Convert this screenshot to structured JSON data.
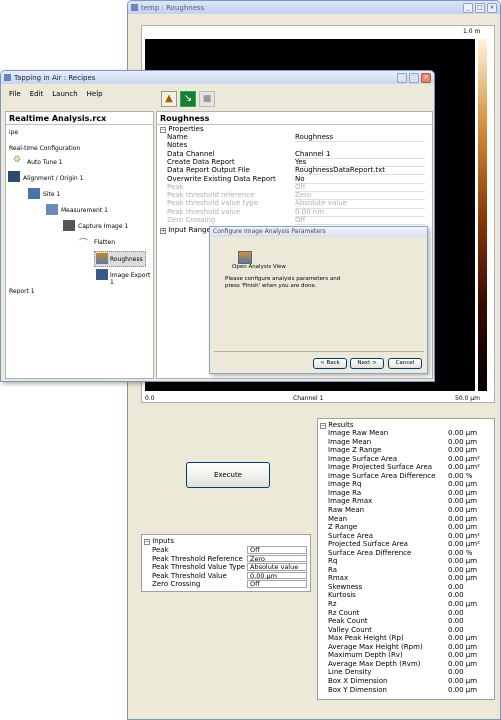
{
  "main_window": {
    "title": "temp : Roughness",
    "axis_top_right": "1.0 m",
    "x_axis_start": "0.0",
    "x_axis_label": "Channel 1",
    "x_axis_end": "50.0 µm",
    "toolbar_icons": [
      "pencil-icon",
      "page-icon",
      "zoom-in-icon",
      "zoom-out-icon",
      "ruler-icon"
    ]
  },
  "recipes_window": {
    "title": "Tapping in Air : Recipes",
    "menu": [
      "File",
      "Edit",
      "Launch",
      "Help"
    ],
    "recipe_title": "Realtime Analysis.rcx",
    "tree": {
      "ipe": "ipe",
      "realtime_configuration": "Real-time Configuration",
      "auto_tune": "Auto Tune 1",
      "alignment": "Alignment / Origin 1",
      "site": "Site 1",
      "measurement": "Measurement 1",
      "capture_image": "Capture Image 1",
      "flatten": "Flatten",
      "roughness": "Roughness",
      "image_export": "Image Export 1",
      "report": "Report 1"
    },
    "section_title": "Roughness",
    "properties_header": "Properties",
    "properties": [
      {
        "label": "Name",
        "value": "Roughness",
        "disabled": false
      },
      {
        "label": "Notes",
        "value": "",
        "disabled": false
      },
      {
        "label": "Data Channel",
        "value": "Channel 1",
        "disabled": false
      },
      {
        "label": "Create Data Report",
        "value": "Yes",
        "disabled": false
      },
      {
        "label": "Data Report Output File",
        "value": "RoughnessDataReport.txt",
        "disabled": false
      },
      {
        "label": "Overwrite Existing Data Report",
        "value": "No",
        "disabled": false
      },
      {
        "label": "Peak",
        "value": "Off",
        "disabled": true
      },
      {
        "label": "Peak threshold reference",
        "value": "Zero",
        "disabled": true
      },
      {
        "label": "Peak threshold value type",
        "value": "Absolute value",
        "disabled": true
      },
      {
        "label": "Peak threshold value",
        "value": "0.00 nm",
        "disabled": true
      },
      {
        "label": "Zero Crossing",
        "value": "Off",
        "disabled": true
      }
    ],
    "input_range_label": "Input Range"
  },
  "wizard": {
    "title": "Configure Image Analysis Parameters",
    "open_view_label": "Open Analysis View",
    "message_line1": "Please configure analysis parameters and",
    "message_line2": "press 'Finish' when you are done.",
    "back_label": "< Back",
    "next_label": "Next >",
    "cancel_label": "Cancel"
  },
  "execute_label": "Execute",
  "inputs": {
    "header": "Inputs",
    "rows": [
      {
        "label": "Peak",
        "value": "Off"
      },
      {
        "label": "Peak Threshold Reference",
        "value": "Zero"
      },
      {
        "label": "Peak Threshold Value Type",
        "value": "Absolute value"
      },
      {
        "label": "Peak Threshold Value",
        "value": "0.00 µm"
      },
      {
        "label": "Zero Crossing",
        "value": "Off"
      }
    ]
  },
  "results": {
    "header": "Results",
    "rows": [
      {
        "label": "Image Raw Mean",
        "value": "0.00 µm"
      },
      {
        "label": "Image Mean",
        "value": "0.00 µm"
      },
      {
        "label": "Image Z Range",
        "value": "0.00 µm"
      },
      {
        "label": "Image Surface Area",
        "value": "0.00 µm²"
      },
      {
        "label": "Image Projected Surface Area",
        "value": "0.00 µm²"
      },
      {
        "label": "Image Surface Area Difference",
        "value": "0.00 %"
      },
      {
        "label": "Image Rq",
        "value": "0.00 µm"
      },
      {
        "label": "Image Ra",
        "value": "0.00 µm"
      },
      {
        "label": "Image Rmax",
        "value": "0.00 µm"
      },
      {
        "label": "Raw Mean",
        "value": "0.00 µm"
      },
      {
        "label": "Mean",
        "value": "0.00 µm"
      },
      {
        "label": "Z Range",
        "value": "0.00 µm"
      },
      {
        "label": "Surface Area",
        "value": "0.00 µm²"
      },
      {
        "label": "Projected Surface Area",
        "value": "0.00 µm²"
      },
      {
        "label": "Surface Area Difference",
        "value": "0.00 %"
      },
      {
        "label": "Rq",
        "value": "0.00 µm"
      },
      {
        "label": "Ra",
        "value": "0.00 µm"
      },
      {
        "label": "Rmax",
        "value": "0.00 µm"
      },
      {
        "label": "Skewness",
        "value": "0.00"
      },
      {
        "label": "Kurtosis",
        "value": "0.00"
      },
      {
        "label": "Rz",
        "value": "0.00 µm"
      },
      {
        "label": "Rz Count",
        "value": "0.00"
      },
      {
        "label": "Peak Count",
        "value": "0.00"
      },
      {
        "label": "Valley Count",
        "value": "0.00"
      },
      {
        "label": "Max Peak Height (Rp)",
        "value": "0.00 µm"
      },
      {
        "label": "Average Max Height (Rpm)",
        "value": "0.00 µm"
      },
      {
        "label": "Maximum Depth (Rv)",
        "value": "0.00 µm"
      },
      {
        "label": "Average Max Depth (Rvm)",
        "value": "0.00 µm"
      },
      {
        "label": "Line Density",
        "value": "0.00"
      },
      {
        "label": "Box X Dimension",
        "value": "0.00 µm"
      },
      {
        "label": "Box Y Dimension",
        "value": "0.00 µm"
      }
    ]
  }
}
